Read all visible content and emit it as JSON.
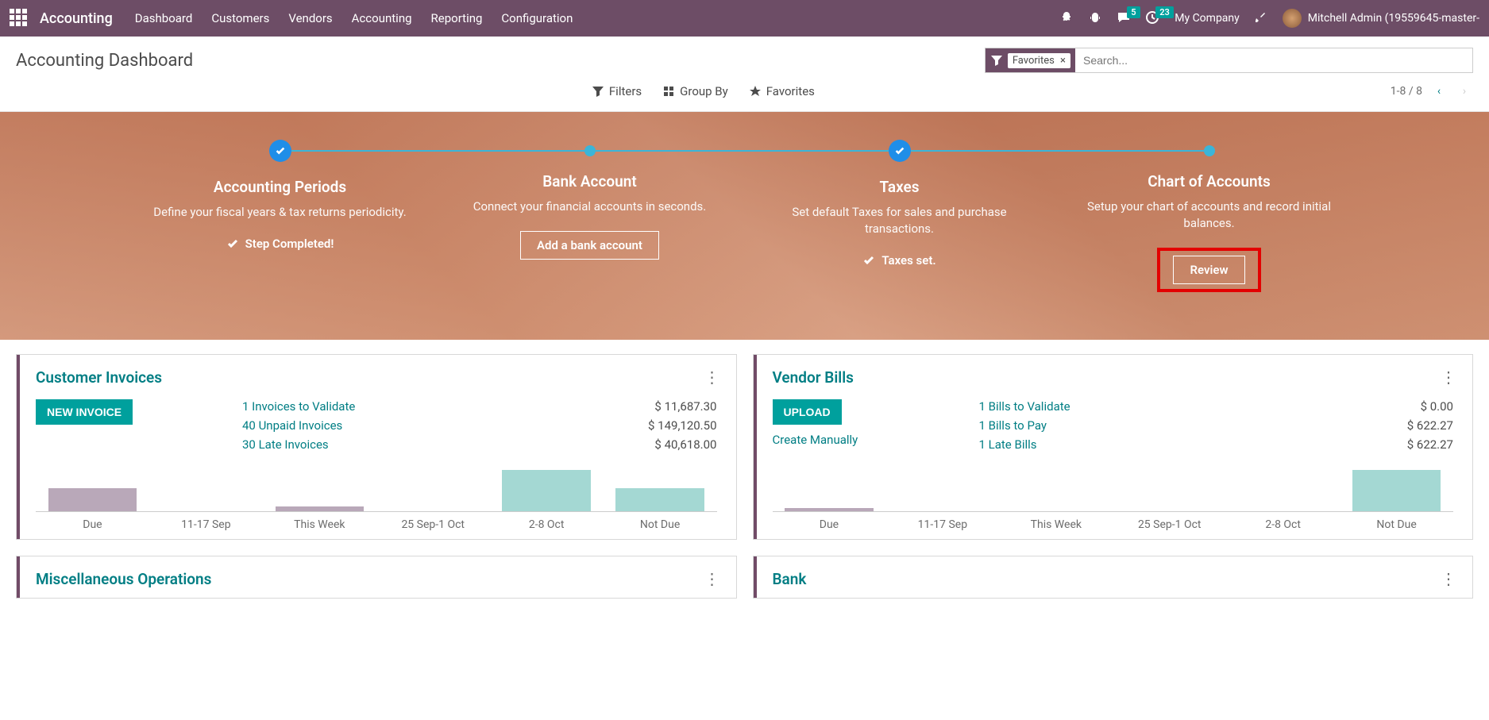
{
  "nav": {
    "brand": "Accounting",
    "items": [
      "Dashboard",
      "Customers",
      "Vendors",
      "Accounting",
      "Reporting",
      "Configuration"
    ],
    "msg_badge": "5",
    "activity_badge": "23",
    "company": "My Company",
    "user": "Mitchell Admin (19559645-master-"
  },
  "page_title": "Accounting Dashboard",
  "search": {
    "facet": "Favorites",
    "placeholder": "Search..."
  },
  "controls": {
    "filters": "Filters",
    "groupby": "Group By",
    "favorites": "Favorites",
    "pager": "1-8 / 8"
  },
  "onboard": {
    "steps": [
      {
        "title": "Accounting Periods",
        "desc": "Define your fiscal years & tax returns periodicity.",
        "status": "Step Completed!",
        "done": true
      },
      {
        "title": "Bank Account",
        "desc": "Connect your financial accounts in seconds.",
        "action": "Add a bank account",
        "done": false
      },
      {
        "title": "Taxes",
        "desc": "Set default Taxes for sales and purchase transactions.",
        "status": "Taxes set.",
        "done": true
      },
      {
        "title": "Chart of Accounts",
        "desc": "Setup your chart of accounts and record initial balances.",
        "action": "Review",
        "done": false,
        "hl": true
      }
    ]
  },
  "cards": {
    "cust": {
      "title": "Customer Invoices",
      "btn": "NEW INVOICE",
      "rows": [
        {
          "label": "1 Invoices to Validate",
          "amt": "$ 11,687.30"
        },
        {
          "label": "40 Unpaid Invoices",
          "amt": "$ 149,120.50"
        },
        {
          "label": "30 Late Invoices",
          "amt": "$ 40,618.00"
        }
      ]
    },
    "vend": {
      "title": "Vendor Bills",
      "btn": "UPLOAD",
      "link": "Create Manually",
      "rows": [
        {
          "label": "1 Bills to Validate",
          "amt": "$ 0.00"
        },
        {
          "label": "1 Bills to Pay",
          "amt": "$ 622.27"
        },
        {
          "label": "1 Late Bills",
          "amt": "$ 622.27"
        }
      ]
    },
    "misc": {
      "title": "Miscellaneous Operations"
    },
    "bank": {
      "title": "Bank"
    }
  },
  "chart_data": [
    {
      "type": "bar",
      "title": "Customer Invoices aging",
      "categories": [
        "Due",
        "11-17 Sep",
        "This Week",
        "25 Sep-1 Oct",
        "2-8 Oct",
        "Not Due"
      ],
      "values": [
        25000,
        0,
        5000,
        0,
        45000,
        25000
      ],
      "colors": [
        "past",
        "past",
        "past",
        "future",
        "future",
        "future"
      ],
      "ylim": [
        0,
        50000
      ]
    },
    {
      "type": "bar",
      "title": "Vendor Bills aging",
      "categories": [
        "Due",
        "11-17 Sep",
        "This Week",
        "25 Sep-1 Oct",
        "2-8 Oct",
        "Not Due"
      ],
      "values": [
        50,
        0,
        0,
        0,
        0,
        622
      ],
      "colors": [
        "past",
        "past",
        "past",
        "future",
        "future",
        "future"
      ],
      "ylim": [
        0,
        700
      ]
    }
  ]
}
